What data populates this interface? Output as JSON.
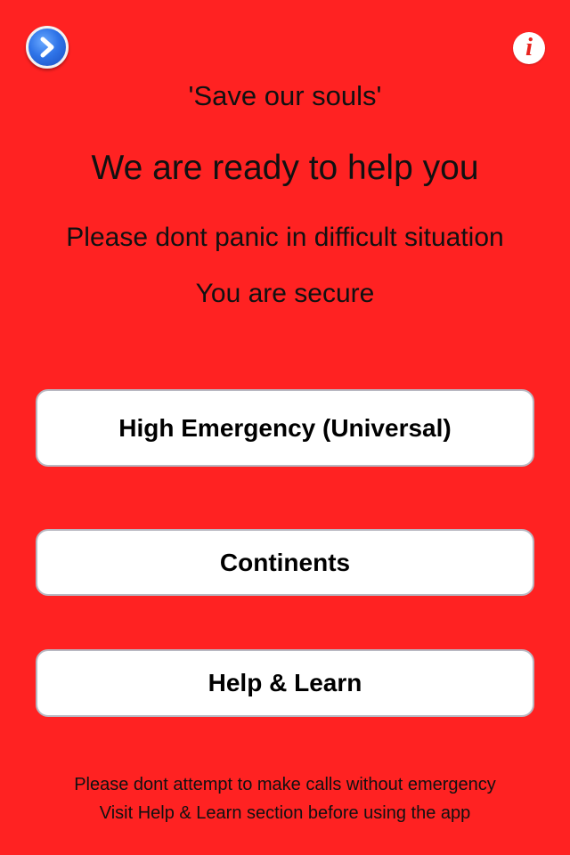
{
  "header": {
    "nav_icon": "chevron-right-icon",
    "info_icon": "info-icon",
    "info_glyph": "i"
  },
  "intro": {
    "motto": "'Save our souls'",
    "headline": "We are ready to help you",
    "line1": "Please dont panic in difficult situation",
    "line2": "You are secure"
  },
  "buttons": {
    "emergency_label": "High Emergency (Universal)",
    "continents_label": "Continents",
    "help_label": "Help & Learn"
  },
  "footer": {
    "line1": "Please dont attempt to make calls without emergency",
    "line2": "Visit Help & Learn section before using the app"
  },
  "colors": {
    "background": "#ff2222",
    "nav_button": "#2f74e8",
    "info_glyph": "#e8241f",
    "button_bg": "#ffffff",
    "button_border": "#b8b8c2"
  }
}
